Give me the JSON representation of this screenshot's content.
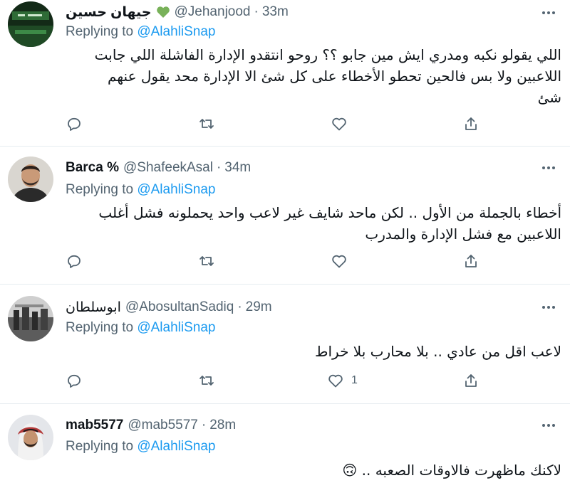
{
  "tweets": [
    {
      "name": "جيهان حسين",
      "name_emoji": "green-heart",
      "handle": "@Jehanjood",
      "separator": "·",
      "time": "33m",
      "replying_prefix": "Replying to",
      "replying_to": "@AlahliSnap",
      "text_lines": [
        "اللي يقولو نكبه ومدري ايش مين جابو ؟؟ روحو انتقدو الإدارة الفاشلة اللي جابت",
        "اللاعبين ولا بس فالحين تحطو الأخطاء على كل شئ الا الإدارة محد يقول عنهم",
        "شئ"
      ],
      "like_count": ""
    },
    {
      "name": "Barca %",
      "handle": "@ShafeekAsal",
      "separator": "·",
      "time": "34m",
      "replying_prefix": "Replying to",
      "replying_to": "@AlahliSnap",
      "text_lines": [
        "أخطاء بالجملة من الأول .. لكن ماحد شايف غير لاعب واحد يحملونه فشل أغلب",
        "اللاعبين مع فشل الإدارة والمدرب"
      ],
      "like_count": ""
    },
    {
      "name": "ابوسلطان",
      "handle": "@AbosultanSadiq",
      "separator": "·",
      "time": "29m",
      "replying_prefix": "Replying to",
      "replying_to": "@AlahliSnap",
      "text_lines": [
        "لاعب اقل من عادي .. بلا محارب بلا خراط"
      ],
      "like_count": "1"
    },
    {
      "name": "mab5577",
      "handle": "@mab5577",
      "separator": "·",
      "time": "28m",
      "replying_prefix": "Replying to",
      "replying_to": "@AlahliSnap",
      "text_lines": [
        "لاكنك ماظهرت فالاوقات الصعبه .. 🙃"
      ],
      "like_count": ""
    }
  ],
  "colors": {
    "link": "#1d9bf0",
    "secondary": "#536471",
    "divider": "#e6ecf0",
    "heart_emoji": "#78b159"
  }
}
